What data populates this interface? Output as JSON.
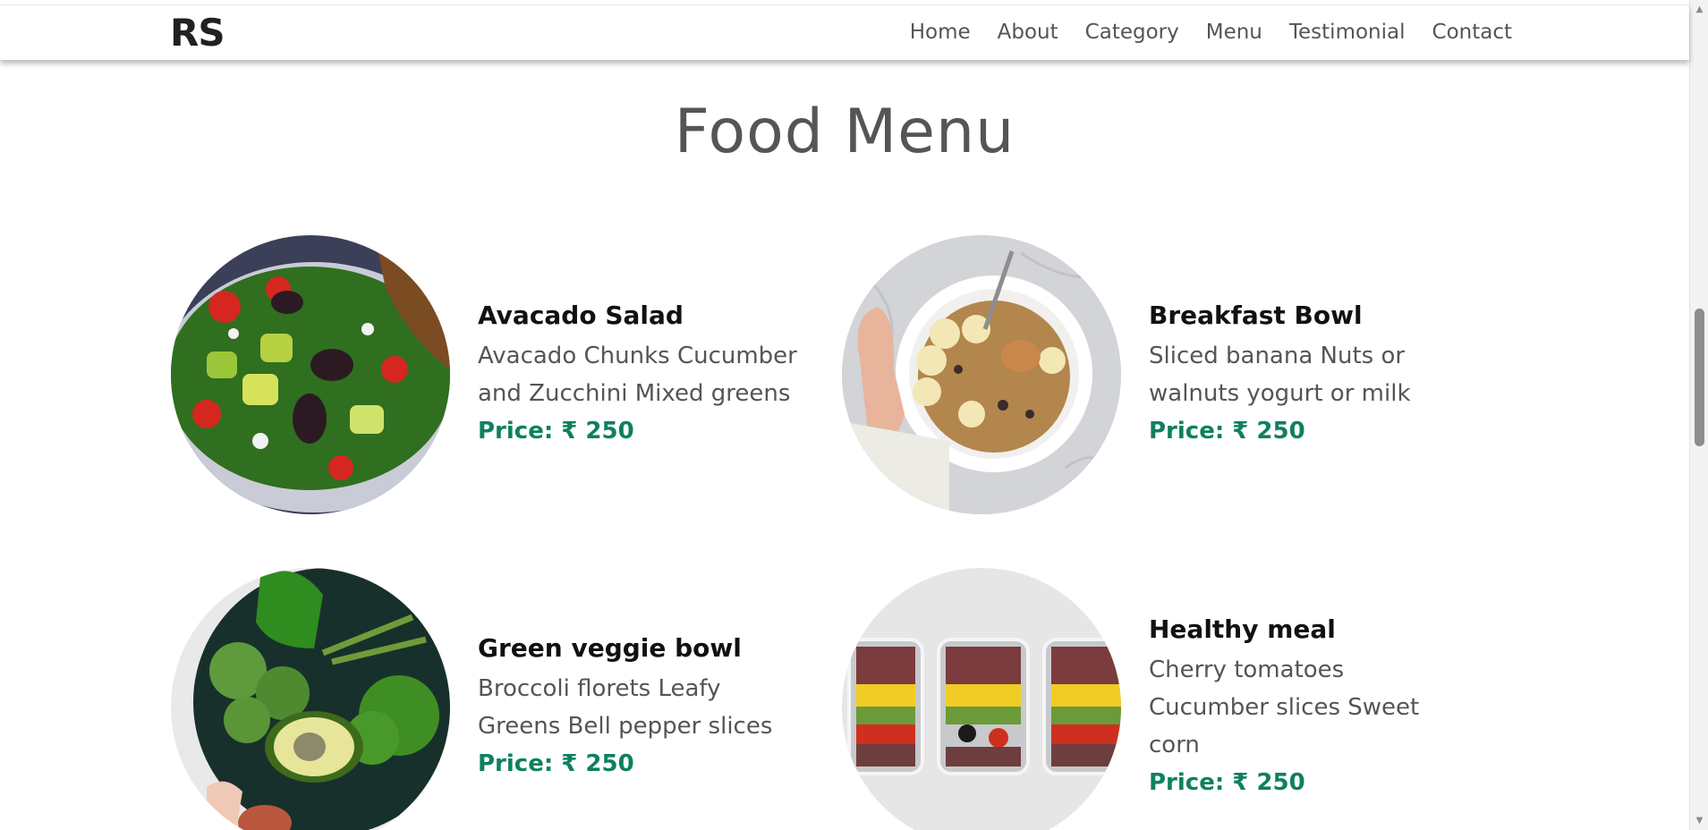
{
  "nav": {
    "brand": "RS",
    "links": [
      "Home",
      "About",
      "Category",
      "Menu",
      "Testimonial",
      "Contact"
    ]
  },
  "section": {
    "title": "Food Menu"
  },
  "menu_items": [
    {
      "name": "Avacado Salad",
      "description": "Avacado Chunks Cucumber and Zucchini Mixed greens",
      "price": "Price: ₹ 250",
      "image_alt": "avocado-salad-photo"
    },
    {
      "name": "Breakfast Bowl",
      "description": "Sliced banana Nuts or walnuts yogurt or milk",
      "price": "Price: ₹ 250",
      "image_alt": "breakfast-bowl-photo"
    },
    {
      "name": "Green veggie bowl",
      "description": "Broccoli florets Leafy Greens Bell pepper slices",
      "price": "Price: ₹ 250",
      "image_alt": "green-veggie-bowl-photo"
    },
    {
      "name": "Healthy meal",
      "description": "Cherry tomatoes Cucumber slices Sweet corn",
      "price": "Price: ₹ 250",
      "image_alt": "healthy-meal-photo"
    }
  ],
  "colors": {
    "price": "#0e8060",
    "heading": "#555555",
    "brand": "#212121"
  }
}
